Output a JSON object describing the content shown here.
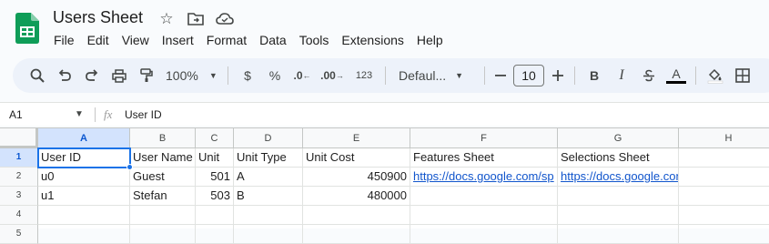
{
  "app": {
    "doc_title": "Users Sheet",
    "menu": [
      "File",
      "Edit",
      "View",
      "Insert",
      "Format",
      "Data",
      "Tools",
      "Extensions",
      "Help"
    ]
  },
  "toolbar": {
    "zoom": "100%",
    "currency": "$",
    "percent": "%",
    "dec_decrease": ".0",
    "dec_increase": ".00",
    "number_format": "123",
    "font": "Defaul...",
    "font_size": "10",
    "bold": "B",
    "italic": "I",
    "text_color": "A"
  },
  "formula_bar": {
    "cell_ref": "A1",
    "fx": "fx",
    "content": "User ID"
  },
  "sheet": {
    "columns": [
      "A",
      "B",
      "C",
      "D",
      "E",
      "F",
      "G",
      "H"
    ],
    "rows": [
      "1",
      "2",
      "3",
      "4",
      "5"
    ],
    "cells": {
      "r1": [
        "User ID",
        "User Name",
        "Unit",
        "Unit Type",
        "Unit Cost",
        "Features Sheet",
        "Selections Sheet",
        ""
      ],
      "r2": [
        "u0",
        "Guest",
        "501",
        "A",
        "450900",
        "https://docs.google.com/sp",
        "https://docs.google.com/spreadsheets/",
        ""
      ],
      "r3": [
        "u1",
        "Stefan",
        "503",
        "B",
        "480000",
        "",
        "",
        ""
      ]
    }
  },
  "colors": {
    "accent": "#1a73e8",
    "link": "#1155cc",
    "header_selected": "#d3e3fd",
    "sheets_green": "#0f9d58"
  }
}
